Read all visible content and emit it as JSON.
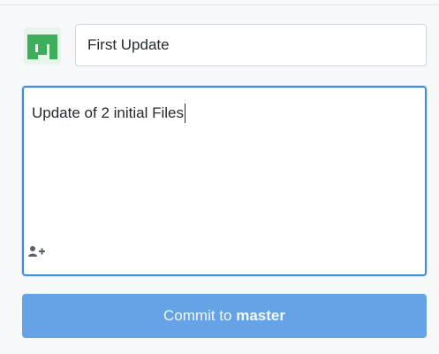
{
  "commit": {
    "summary_value": "First Update",
    "description_value": "Update of 2 initial Files",
    "button_prefix": "Commit to",
    "branch": "master"
  },
  "icons": {
    "avatar": "identicon-avatar",
    "coauthor": "add-coauthor-icon"
  },
  "colors": {
    "accent": "#3d8ee0",
    "button": "#66a3e6",
    "avatar": "#3dae5b"
  }
}
